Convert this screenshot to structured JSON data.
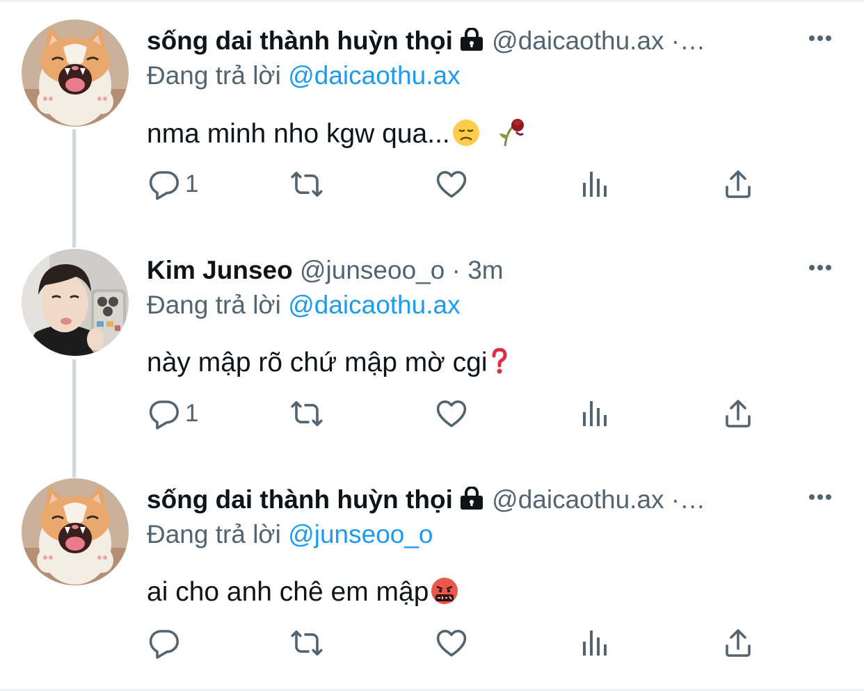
{
  "tweets": [
    {
      "display_name": "sống dai thành huỳn thọi",
      "handle": "@daicaothu.ax",
      "separator": " ·",
      "time": "",
      "truncation": "…",
      "replying_prefix": "Đang trả lời",
      "replying_to": "@daicaothu.ax",
      "text": "nma minh nho kgw qua...",
      "emojis": [
        "disappointed-face",
        "wilted-flower"
      ],
      "locked": true,
      "reply_count": "1",
      "avatar": "orange-cat"
    },
    {
      "display_name": "Kim Junseo",
      "handle": "@junseoo_o",
      "separator": " · ",
      "time": "3m",
      "truncation": "",
      "replying_prefix": "Đang trả lời",
      "replying_to": "@daicaothu.ax",
      "text": "này mập rõ chứ mập mờ cgi",
      "emojis": [
        "red-question-mark"
      ],
      "locked": false,
      "reply_count": "1",
      "avatar": "person-photo"
    },
    {
      "display_name": "sống dai thành huỳn thọi",
      "handle": "@daicaothu.ax",
      "separator": " ·",
      "time": "",
      "truncation": "…",
      "replying_prefix": "Đang trả lời",
      "replying_to": "@junseoo_o",
      "text": "ai cho anh chê em mập",
      "emojis": [
        "face-with-symbols"
      ],
      "locked": true,
      "reply_count": "",
      "avatar": "orange-cat"
    }
  ],
  "icons": [
    "reply-icon",
    "retweet-icon",
    "like-icon",
    "views-icon",
    "share-icon",
    "more-icon",
    "lock-icon"
  ],
  "colors": {
    "text": "#0f1419",
    "secondary": "#536471",
    "link": "#1d9bf0",
    "thread": "#cfd9de"
  }
}
